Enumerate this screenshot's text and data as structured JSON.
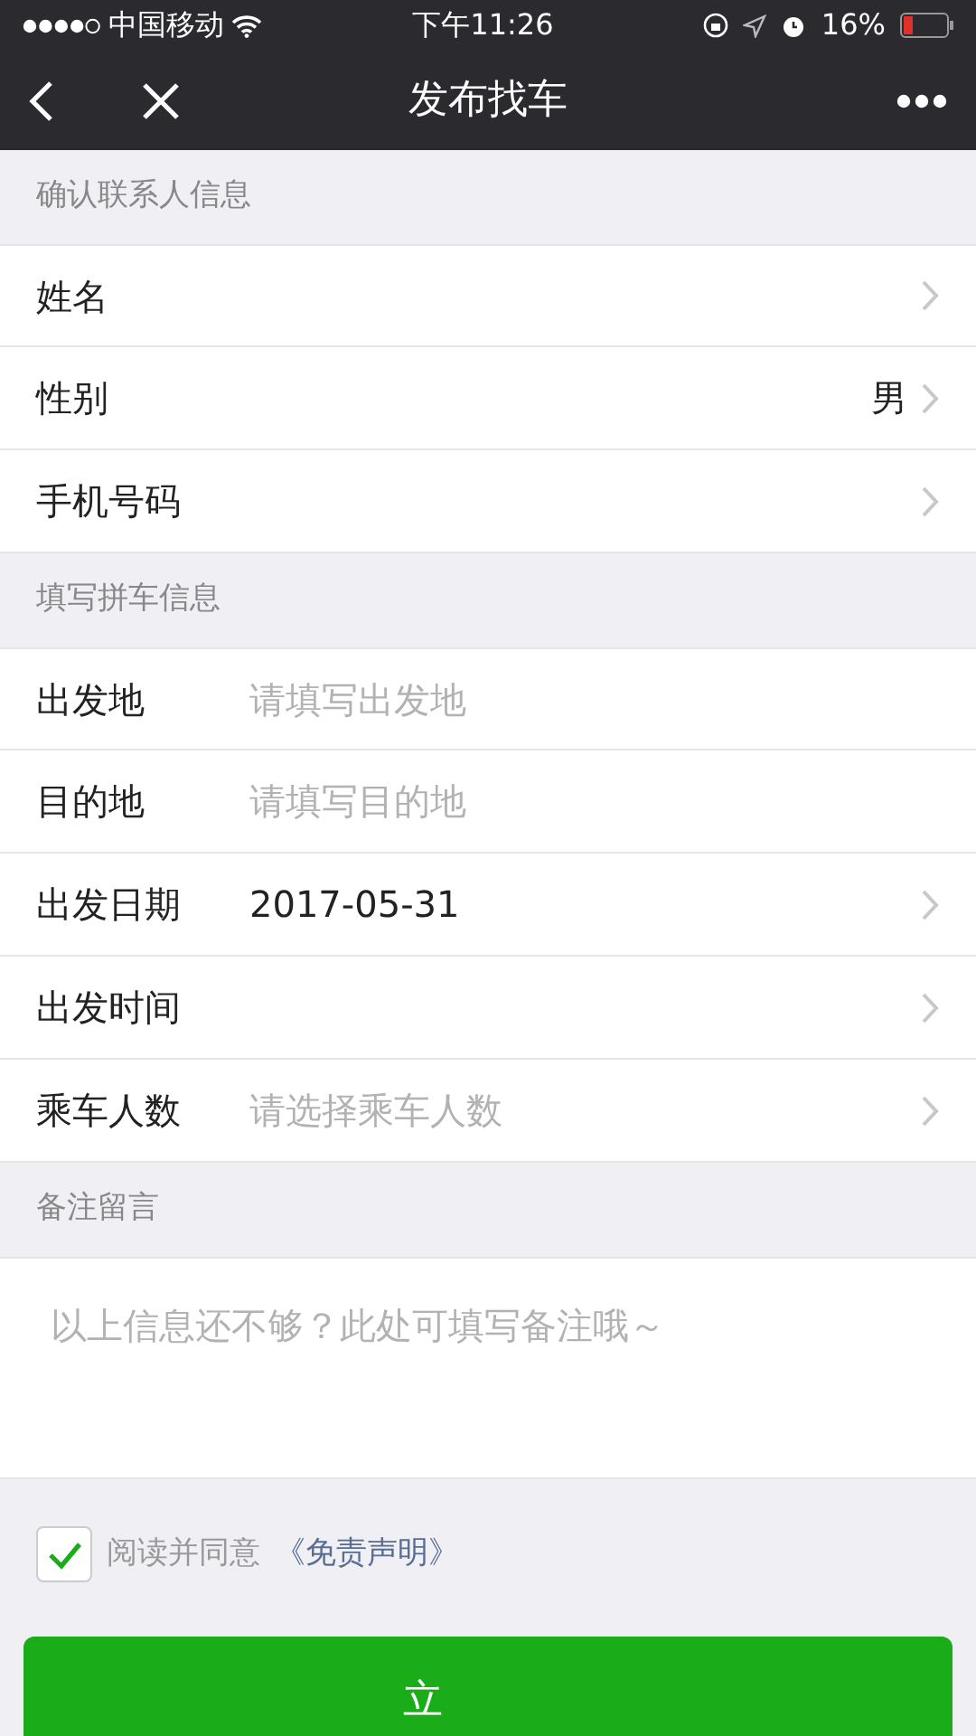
{
  "status_bar": {
    "carrier": "中国移动",
    "time": "下午11:26",
    "battery": "16%"
  },
  "nav": {
    "title": "发布找车"
  },
  "sections": [
    {
      "header": "确认联系人信息",
      "rows": [
        {
          "kind": "select",
          "label": "姓名"
        },
        {
          "kind": "select",
          "label": "性别",
          "value": "男"
        },
        {
          "kind": "select",
          "label": "手机号码"
        }
      ]
    },
    {
      "header": "填写拼车信息",
      "rows": [
        {
          "kind": "input",
          "label": "出发地",
          "placeholder": "请填写出发地"
        },
        {
          "kind": "input",
          "label": "目的地",
          "placeholder": "请填写目的地"
        },
        {
          "kind": "select",
          "label": "出发日期",
          "value": "2017-05-31"
        },
        {
          "kind": "select",
          "label": "出发时间"
        },
        {
          "kind": "select",
          "label": "乘车人数",
          "placeholder": "请选择乘车人数"
        }
      ]
    },
    {
      "header": "备注留言",
      "textarea": {
        "placeholder": "以上信息还不够？此处可填写备注哦～"
      }
    }
  ],
  "agreement": {
    "checked": true,
    "text": "阅读并同意",
    "link": "《免责声明》"
  },
  "submit": {
    "label": "立"
  }
}
